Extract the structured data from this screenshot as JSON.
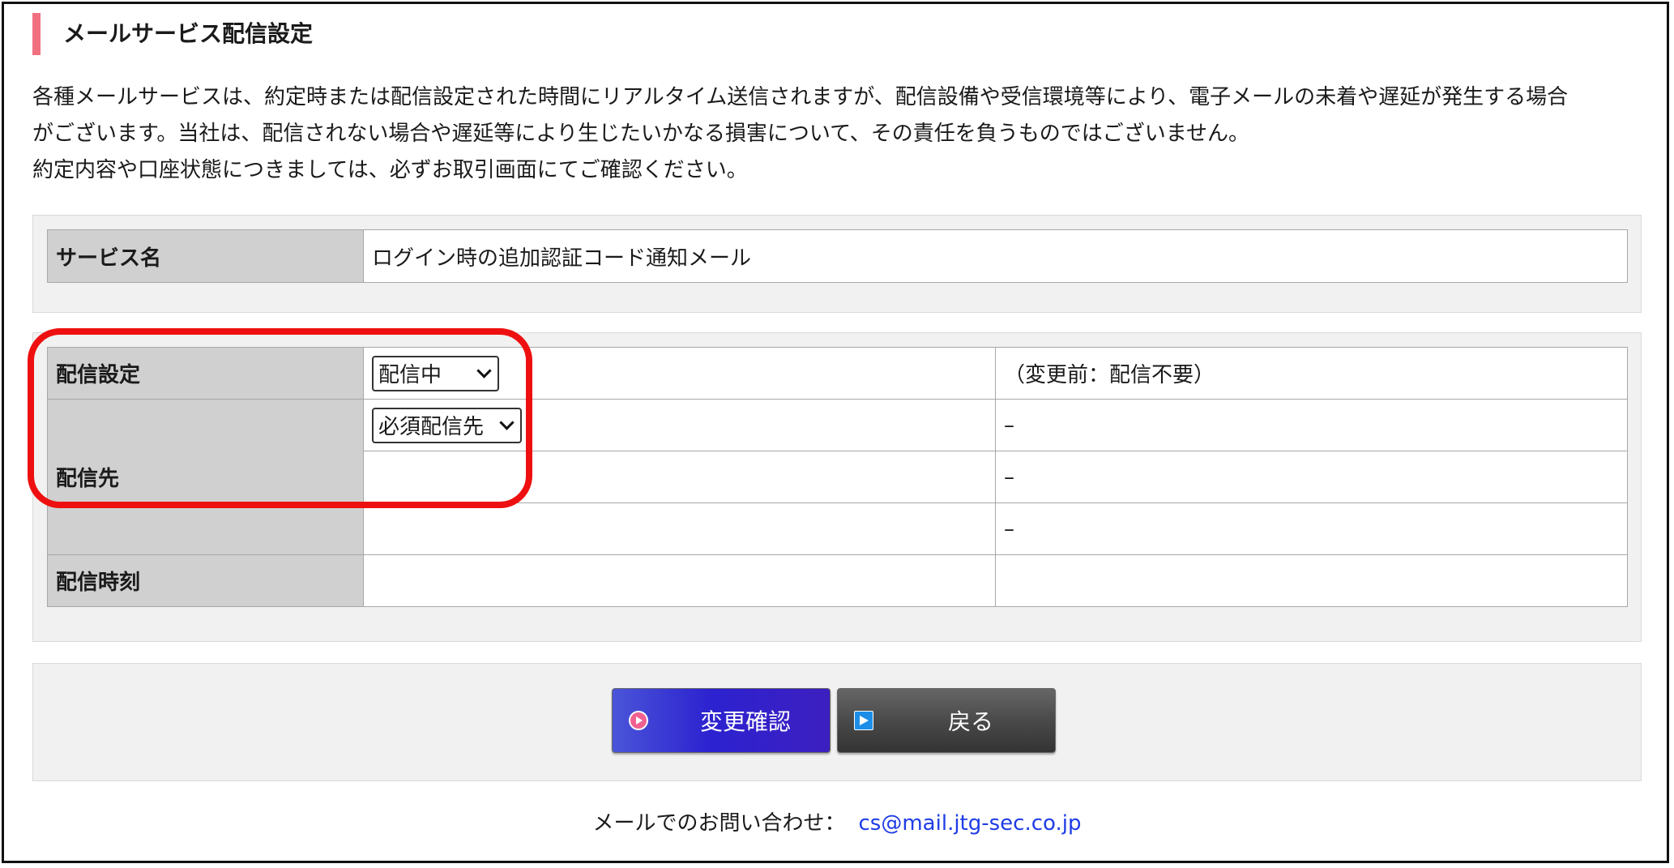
{
  "page": {
    "title": "メールサービス配信設定"
  },
  "notice": {
    "lines": [
      "各種メールサービスは、約定時または配信設定された時間にリアルタイム送信されますが、配信設備や受信環境等により、電子メールの未着や遅延が発生する場合",
      "がございます。当社は、配信されない場合や遅延等により生じたいかなる損害について、その責任を負うものではございません。",
      "約定内容や口座状態につきましては、必ずお取引画面にてご確認ください。"
    ]
  },
  "service": {
    "label": "サービス名",
    "value": "ログイン時の追加認証コード通知メール"
  },
  "settings": {
    "delivery": {
      "label": "配信設定",
      "selected": "配信中",
      "previous": "（変更前：配信不要）"
    },
    "destination": {
      "label": "配信先",
      "selected": "必須配信先",
      "rows": [
        {
          "previous": "–"
        },
        {
          "previous": "–"
        },
        {
          "previous": "–"
        }
      ]
    },
    "time": {
      "label": "配信時刻"
    }
  },
  "buttons": {
    "confirm": "変更確認",
    "back": "戻る"
  },
  "contact": {
    "label": "メールでのお問い合わせ：",
    "email": "cs@mail.jtg-sec.co.jp"
  },
  "colors": {
    "accent_bar": "#f07080",
    "highlight": "#ee1010",
    "link": "#1e3ce6",
    "confirm_button": "#2c22d0"
  },
  "icons": {
    "confirm": "play-icon",
    "back": "arrow-right-icon"
  }
}
